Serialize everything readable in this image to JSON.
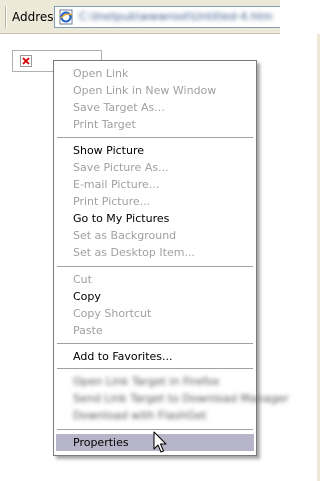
{
  "address_bar": {
    "label": "Address",
    "url": "C:\\Inetpub\\wwwroot\\Untitled-4.htm"
  },
  "context_menu": {
    "groups": [
      [
        {
          "label": "Open Link",
          "state": "disabled"
        },
        {
          "label": "Open Link in New Window",
          "state": "disabled"
        },
        {
          "label": "Save Target As...",
          "state": "disabled"
        },
        {
          "label": "Print Target",
          "state": "disabled"
        }
      ],
      [
        {
          "label": "Show Picture",
          "state": "enabled"
        },
        {
          "label": "Save Picture As...",
          "state": "disabled"
        },
        {
          "label": "E-mail Picture...",
          "state": "disabled"
        },
        {
          "label": "Print Picture...",
          "state": "disabled"
        },
        {
          "label": "Go to My Pictures",
          "state": "enabled"
        },
        {
          "label": "Set as Background",
          "state": "disabled"
        },
        {
          "label": "Set as Desktop Item...",
          "state": "disabled"
        }
      ],
      [
        {
          "label": "Cut",
          "state": "disabled"
        },
        {
          "label": "Copy",
          "state": "enabled"
        },
        {
          "label": "Copy Shortcut",
          "state": "disabled"
        },
        {
          "label": "Paste",
          "state": "disabled"
        }
      ],
      [
        {
          "label": "Add to Favorites...",
          "state": "enabled"
        }
      ],
      [
        {
          "label": "Open Link Target in Firefox",
          "state": "blurred"
        },
        {
          "label": "Send Link Target to Download Manager",
          "state": "blurred"
        },
        {
          "label": "Download with FlashGet",
          "state": "blurred"
        }
      ],
      [
        {
          "label": "Properties",
          "state": "highlighted"
        }
      ]
    ]
  },
  "colors": {
    "toolbar_bg": "#ece9d8",
    "menu_highlight": "#b6b4c8",
    "disabled_text": "#a0a0a0",
    "broken_image_x": "#d40000"
  },
  "icons": {
    "address_icon": "ie-page-icon",
    "placeholder_icon": "broken-image-icon",
    "cursor": "arrow-cursor-icon"
  }
}
